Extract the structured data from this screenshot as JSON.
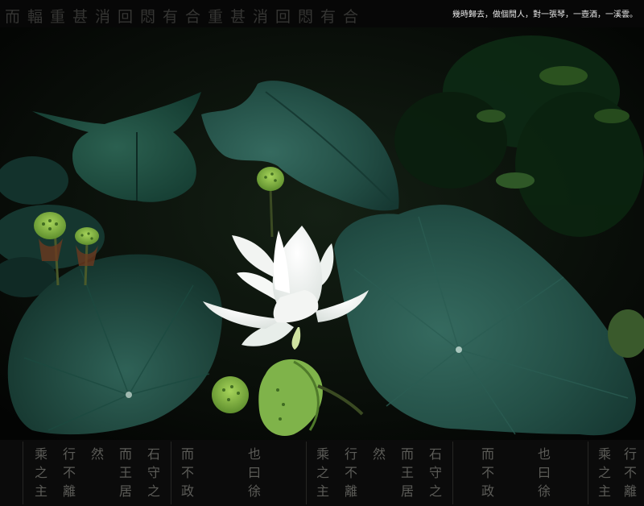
{
  "header": {
    "background_script": "而輻重甚消回悶有合重甚消回悶有合",
    "poem": "幾時歸去，做個閒人，對一張琴，一壺酒，一溪雲。"
  },
  "footer": {
    "calligraphy_columns": [
      "乘之主",
      "行不離",
      "然",
      "而王居",
      "石守之",
      "而不政",
      "也曰徐",
      "乘之主",
      "行不離",
      "然",
      "而王居",
      "石守之",
      "而不政",
      "也曰徐",
      "乘之主",
      "行不離"
    ]
  },
  "colors": {
    "lotus_petal": "#f4f6f4",
    "leaf_dark": "#1f4a42",
    "leaf_mid": "#2e6157",
    "seedpod": "#8fc24a",
    "background": "#050605"
  }
}
